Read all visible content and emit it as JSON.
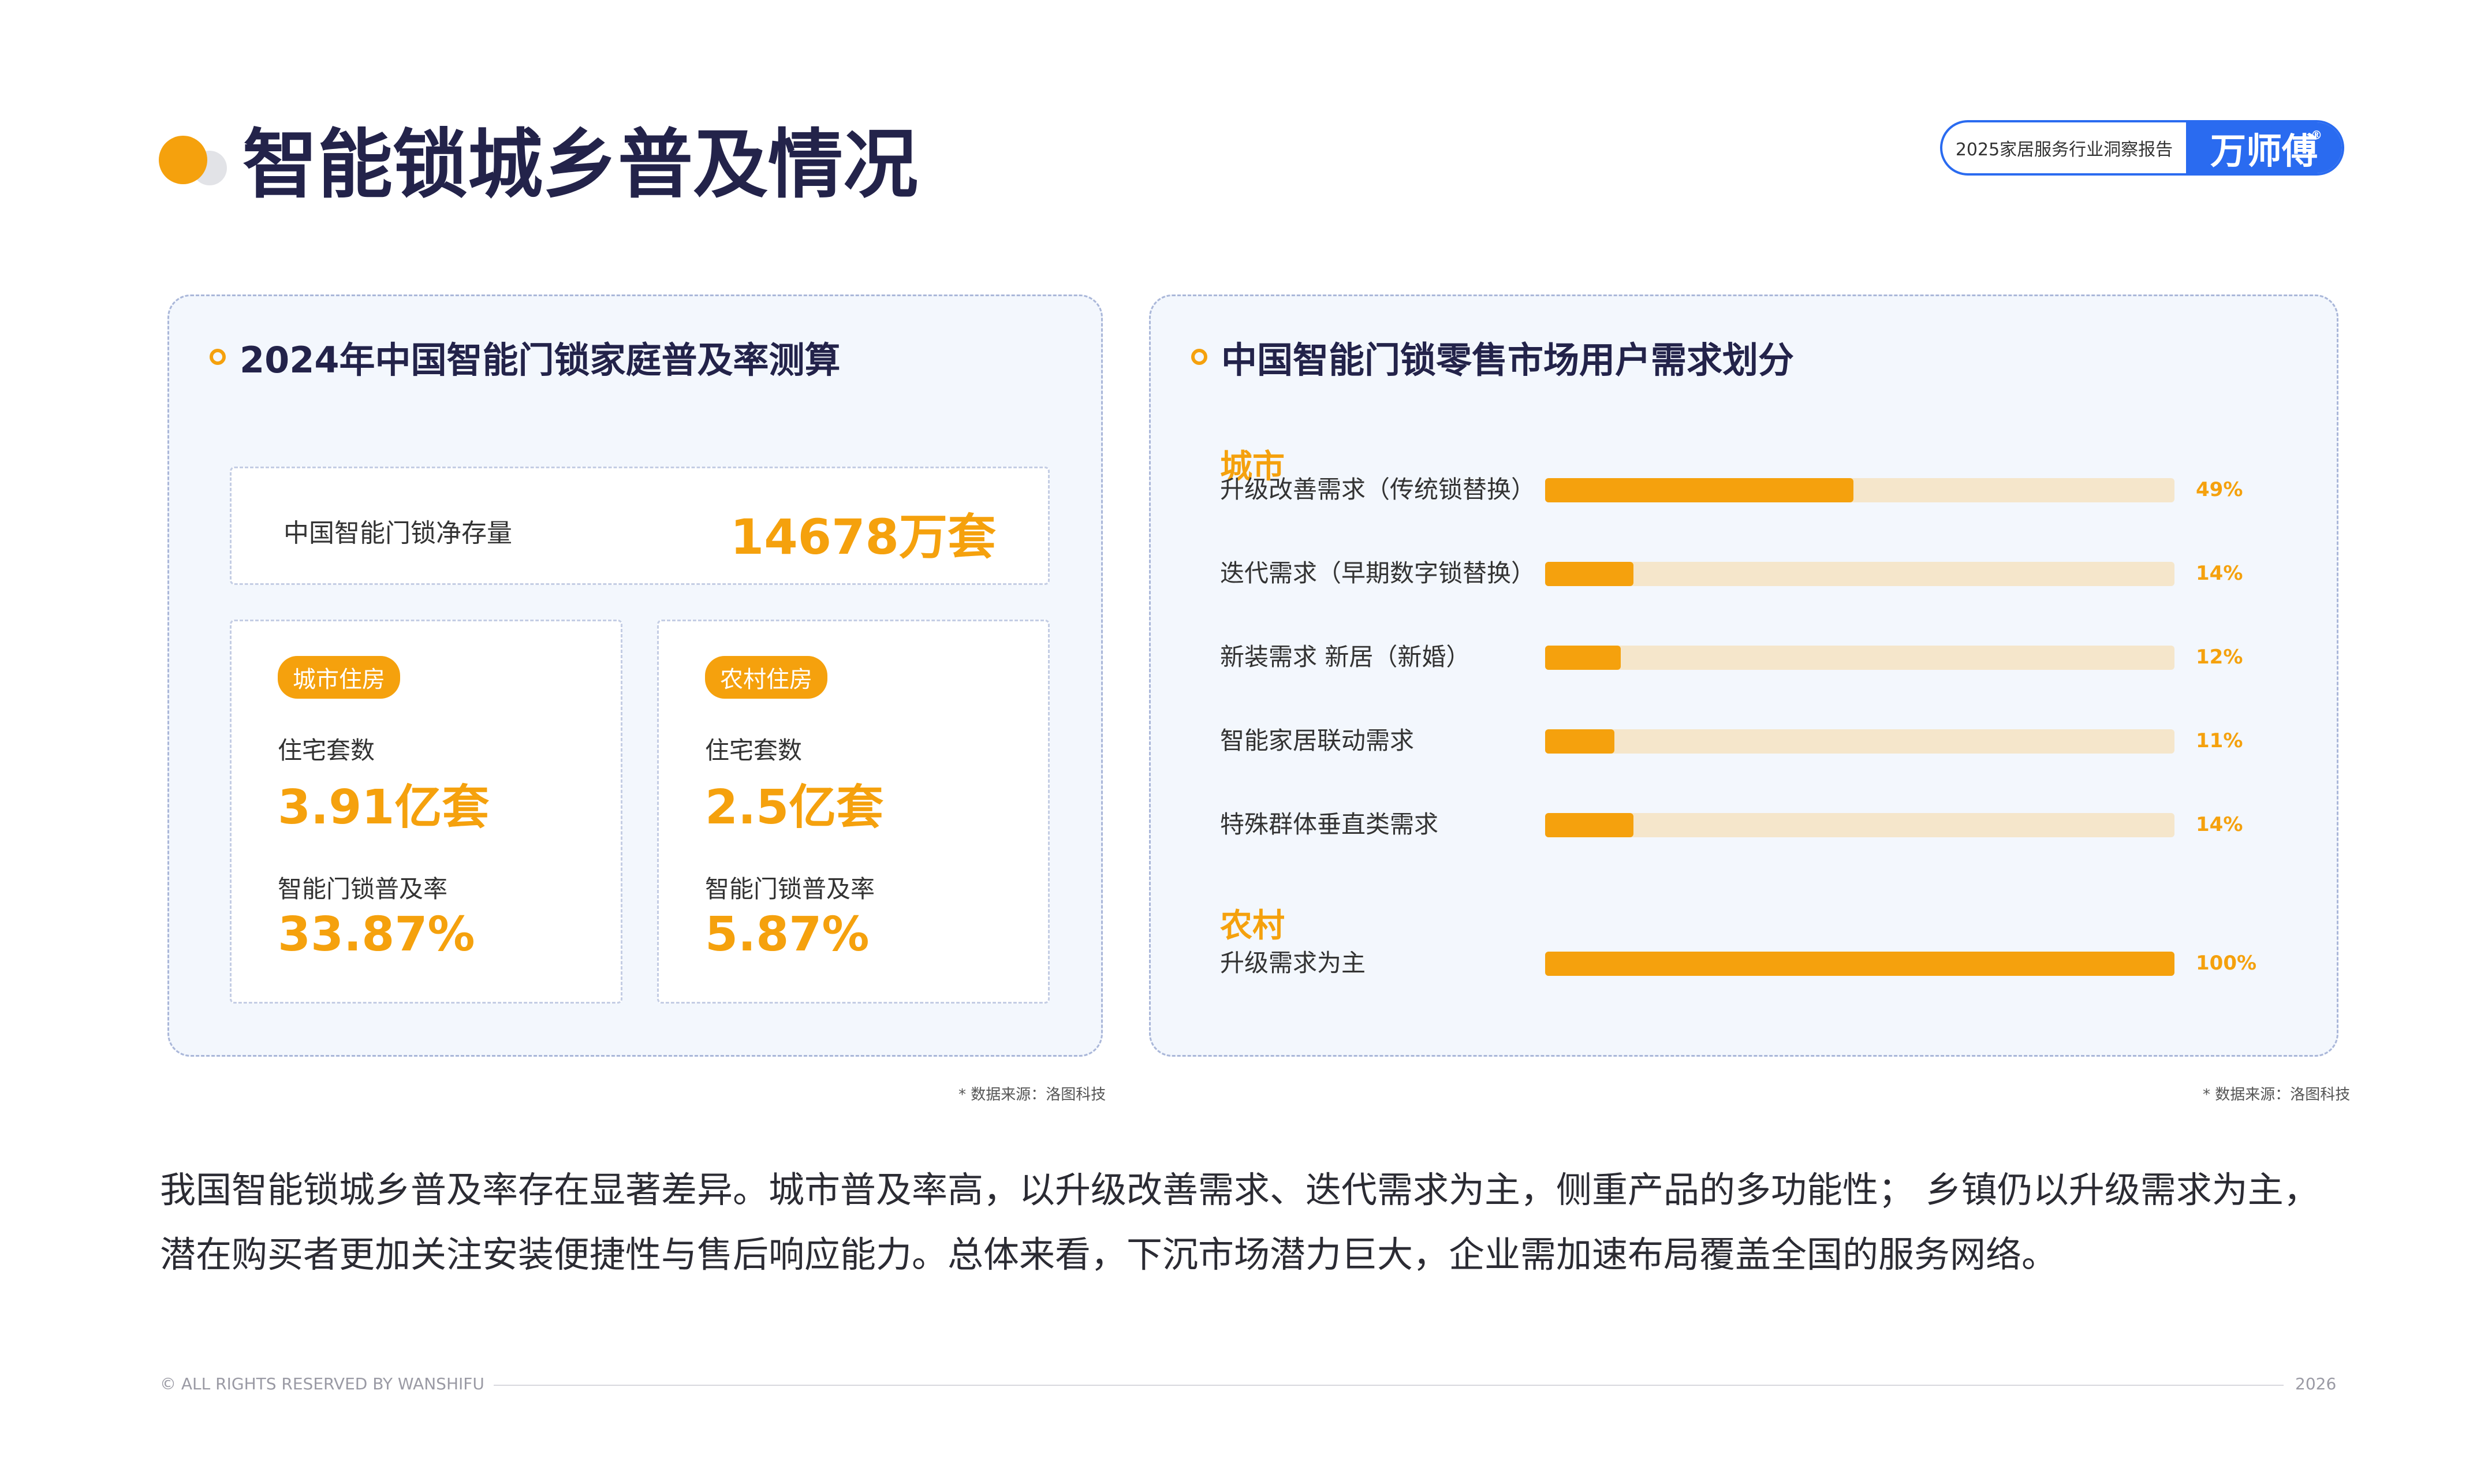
{
  "page": {
    "title": "智能锁城乡普及情况",
    "brand": {
      "report": "2025家居服务行业洞察报告",
      "name": "万师傅",
      "registered_mark": "®"
    }
  },
  "left_panel": {
    "title": "2024年中国智能门锁家庭普及率测算",
    "stock": {
      "label": "中国智能门锁净存量",
      "value": "14678万套"
    },
    "urban": {
      "tag": "城市住房",
      "households_label": "住宅套数",
      "households_value": "3.91亿套",
      "rate_label": "智能门锁普及率",
      "rate_value": "33.87%"
    },
    "rural": {
      "tag": "农村住房",
      "households_label": "住宅套数",
      "households_value": "2.5亿套",
      "rate_label": "智能门锁普及率",
      "rate_value": "5.87%"
    },
    "source": "* 数据来源：洛图科技"
  },
  "right_panel": {
    "title": "中国智能门锁零售市场用户需求划分",
    "source": "* 数据来源：洛图科技"
  },
  "chart_data": {
    "type": "bar",
    "orientation": "horizontal",
    "title": "中国智能门锁零售市场用户需求划分",
    "groups": [
      {
        "name": "城市",
        "categories": [
          "升级改善需求（传统锁替换）",
          "迭代需求（早期数字锁替换）",
          "新装需求  新居（新婚）",
          "智能家居联动需求",
          "特殊群体垂直类需求"
        ],
        "values": [
          49,
          14,
          12,
          11,
          14
        ],
        "labels": [
          "49%",
          "14%",
          "12%",
          "11%",
          "14%"
        ]
      },
      {
        "name": "农村",
        "categories": [
          "升级需求为主"
        ],
        "values": [
          100
        ],
        "labels": [
          "100%"
        ]
      }
    ],
    "xlim": [
      0,
      100
    ],
    "unit": "%",
    "colors": {
      "fill": "#F5A10D",
      "track": "#F5E6CB"
    }
  },
  "summary": "我国智能锁城乡普及率存在显著差异。城市普及率高，以升级改善需求、迭代需求为主，侧重产品的多功能性； 乡镇仍以升级需求为主，潜在购买者更加关注安装便捷性与售后响应能力。总体来看，下沉市场潜力巨大，企业需加速布局覆盖全国的服务网络。",
  "footer": {
    "copyright": "© ALL RIGHTS RESERVED BY WANSHIFU",
    "year": "2026"
  },
  "colors": {
    "accent": "#F5A10D",
    "brand_blue": "#2A6BF0",
    "title": "#23234A",
    "panel_bg": "#F3F7FD"
  }
}
